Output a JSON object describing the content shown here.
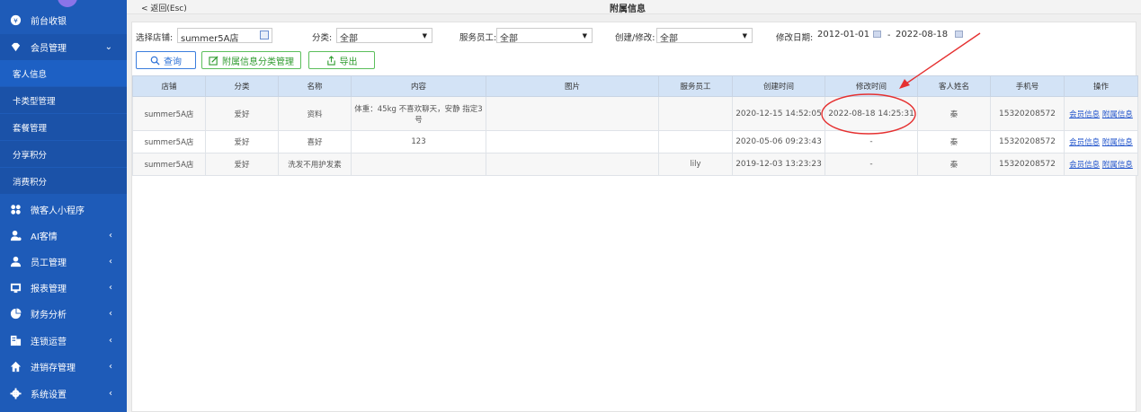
{
  "sidebar": {
    "items": [
      {
        "label": "前台收银",
        "icon": "cashier-icon"
      },
      {
        "label": "会员管理",
        "icon": "diamond-icon",
        "chevron": "⌄"
      },
      {
        "label": "客人信息"
      },
      {
        "label": "卡类型管理"
      },
      {
        "label": "套餐管理"
      },
      {
        "label": "分享积分"
      },
      {
        "label": "消费积分"
      },
      {
        "label": "微客人小程序",
        "icon": "mini-program-icon"
      },
      {
        "label": "AI客情",
        "icon": "ai-icon",
        "chevron": "‹"
      },
      {
        "label": "员工管理",
        "icon": "user-icon",
        "chevron": "‹"
      },
      {
        "label": "报表管理",
        "icon": "report-icon",
        "chevron": "‹"
      },
      {
        "label": "财务分析",
        "icon": "pie-icon",
        "chevron": "‹"
      },
      {
        "label": "连锁运营",
        "icon": "building-icon",
        "chevron": "‹"
      },
      {
        "label": "进销存管理",
        "icon": "home-icon",
        "chevron": "‹"
      },
      {
        "label": "系统设置",
        "icon": "gear-icon",
        "chevron": "‹"
      }
    ]
  },
  "header": {
    "back": "< 返回(Esc)",
    "title": "附属信息"
  },
  "filters": {
    "store_label": "选择店铺:",
    "store_value": "summer5A店",
    "category_label": "分类:",
    "category_value": "全部",
    "staff_label": "服务员工:",
    "staff_value": "全部",
    "create_label": "创建/修改:",
    "create_value": "全部",
    "date_label": "修改日期:",
    "date_from": "2012-01-01",
    "date_sep": "-",
    "date_to": "2022-08-18"
  },
  "buttons": {
    "query": "查询",
    "manage": "附属信息分类管理",
    "export": "导出"
  },
  "table": {
    "headers": [
      "店铺",
      "分类",
      "名称",
      "内容",
      "图片",
      "服务员工",
      "创建时间",
      "修改时间",
      "客人姓名",
      "手机号",
      "操作"
    ],
    "rows": [
      {
        "store": "summer5A店",
        "category": "爱好",
        "name": "资料",
        "content": "体重：45kg 不喜欢聊天，安静 指定3号",
        "image": "",
        "staff": "",
        "created": "2020-12-15 14:52:05",
        "modified": "2022-08-18 14:25:31",
        "customer": "秦",
        "phone": "15320208572",
        "op1": "会员信息",
        "op2": "附属信息"
      },
      {
        "store": "summer5A店",
        "category": "爱好",
        "name": "喜好",
        "content": "123",
        "image": "",
        "staff": "",
        "created": "2020-05-06 09:23:43",
        "modified": "-",
        "customer": "秦",
        "phone": "15320208572",
        "op1": "会员信息",
        "op2": "附属信息"
      },
      {
        "store": "summer5A店",
        "category": "爱好",
        "name": "洗发不用护发素",
        "content": "",
        "image": "",
        "staff": "lily",
        "created": "2019-12-03 13:23:23",
        "modified": "-",
        "customer": "秦",
        "phone": "15320208572",
        "op1": "会员信息",
        "op2": "附属信息"
      }
    ]
  },
  "colors": {
    "sidebar": "#1e5bb8",
    "header_bg": "#d3e3f6",
    "annotation": "#e53030"
  }
}
